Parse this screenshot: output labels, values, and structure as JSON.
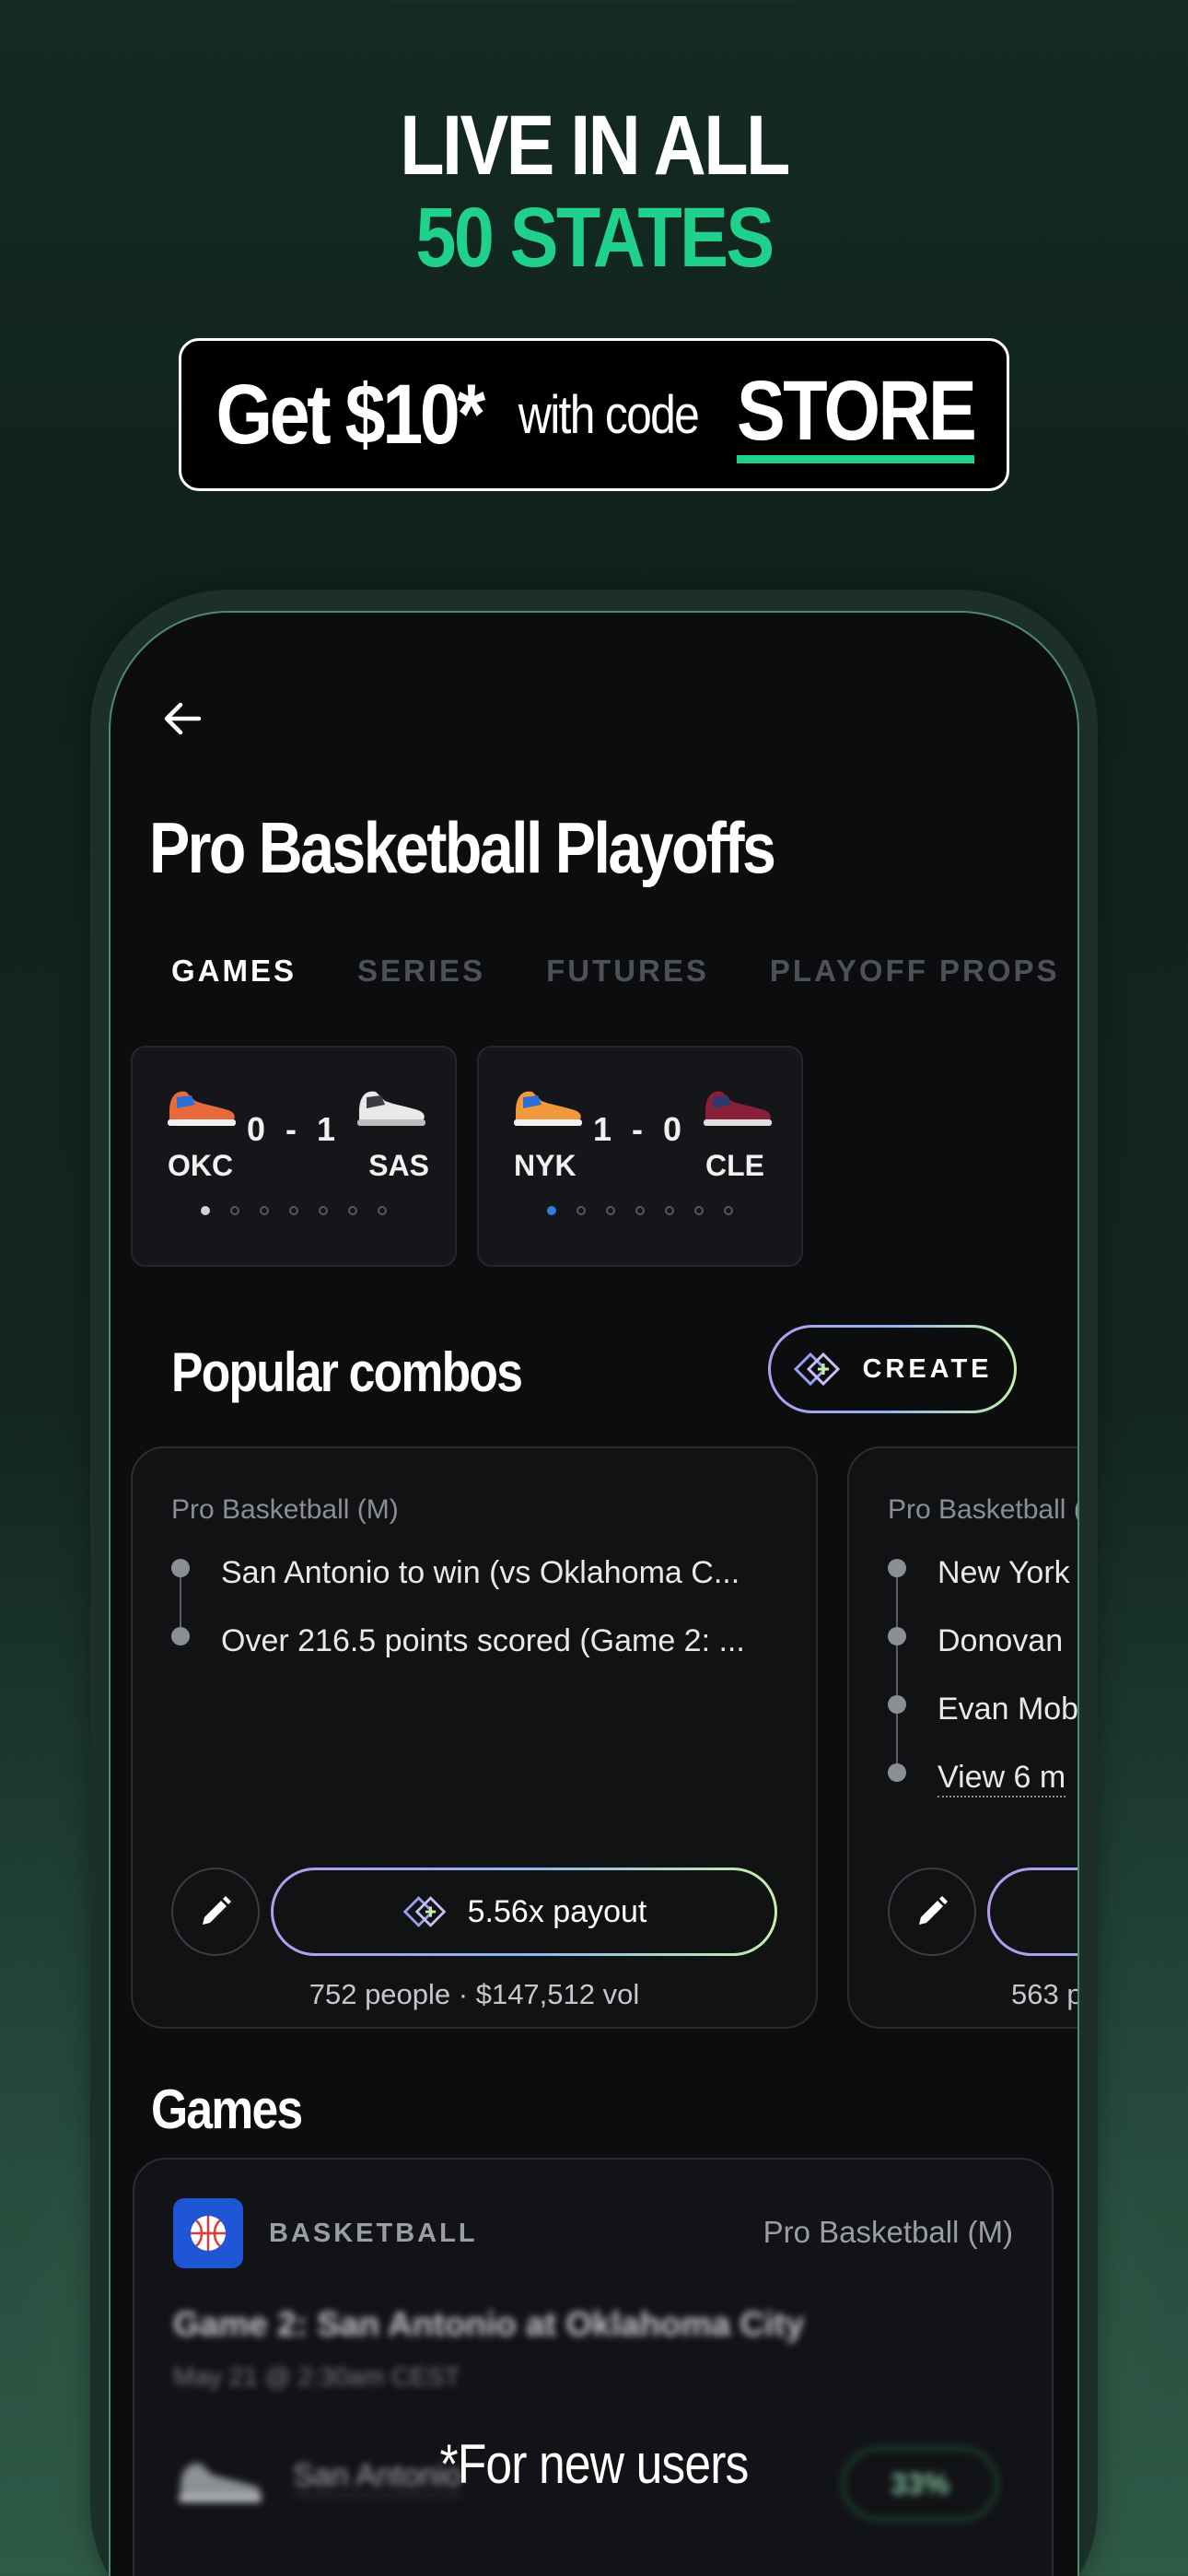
{
  "hero": {
    "line1": "LIVE IN ALL",
    "line2": "50 STATES"
  },
  "promo": {
    "amount": "Get $10*",
    "with_code": "with code",
    "code": "STORE"
  },
  "app": {
    "title": "Pro Basketball Playoffs",
    "tabs": [
      "GAMES",
      "SERIES",
      "FUTURES",
      "PLAYOFF PROPS"
    ],
    "active_tab": "GAMES",
    "series": [
      {
        "home": "OKC",
        "away": "SAS",
        "score": "0 - 1",
        "games_shown": 7,
        "active_dot_color": "#cfd2d6"
      },
      {
        "home": "NYK",
        "away": "CLE",
        "score": "1 - 0",
        "games_shown": 7,
        "active_dot_color": "#2c7fe0"
      }
    ],
    "popular_combos": {
      "title": "Popular combos",
      "create_label": "CREATE",
      "cards": [
        {
          "league": "Pro Basketball (M)",
          "legs": [
            "San Antonio to win (vs Oklahoma C...",
            "Over 216.5 points scored (Game 2: ..."
          ],
          "payout": "5.56x payout",
          "stats": "752 people · $147,512 vol"
        },
        {
          "league": "Pro Basketball (M)",
          "legs": [
            "New York",
            "Donovan",
            "Evan Mob",
            "View 6 m"
          ],
          "payout": "",
          "stats": "563 p"
        }
      ]
    },
    "games": {
      "title": "Games",
      "card": {
        "sport": "BASKETBALL",
        "league": "Pro Basketball (M)",
        "title": "Game 2: San Antonio at Oklahoma City",
        "date": "May 21 @ 2:30am CEST",
        "team": "San Antonio",
        "odds": "33%"
      }
    }
  },
  "footnote": "*For new users",
  "colors": {
    "accent_green": "#1fd18d",
    "screen_bg": "#0c0d0f",
    "sport_icon_bg": "#1e56d6"
  }
}
